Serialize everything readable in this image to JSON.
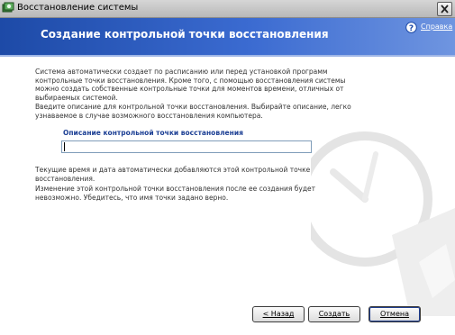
{
  "window": {
    "title": "Восстановление системы"
  },
  "header": {
    "title": "Создание контрольной точки восстановления",
    "help_label": "Справка"
  },
  "body": {
    "paragraph1": "Система автоматически создает по расписанию или перед установкой программ контрольные точки восстановления. Кроме того, с помощью восстановления системы можно создать собственные контрольные точки для моментов времени, отличных от выбираемых системой.",
    "paragraph2": "Введите описание для контрольной точки восстановления. Выбирайте описание, легко узнаваемое в случае возможного восстановления компьютера.",
    "field_label": "Описание контрольной точки восстановления",
    "field_value": "",
    "paragraph3": "Текущие время и дата автоматически добавляются этой контрольной точке восстановления.",
    "paragraph4": "Изменение этой контрольной точки восстановления после ее создания будет невозможно. Убедитесь, что имя точки задано верно."
  },
  "buttons": {
    "back": "< Назад",
    "create": "Создать",
    "cancel": "Отмена"
  },
  "colors": {
    "header_start": "#1d4aa7",
    "header_end": "#6f95e0",
    "label_blue": "#1c3f94"
  },
  "icons": {
    "app": "system-restore-icon",
    "help": "help-icon",
    "close": "close-icon",
    "watermark": "clock-watermark-icon"
  }
}
